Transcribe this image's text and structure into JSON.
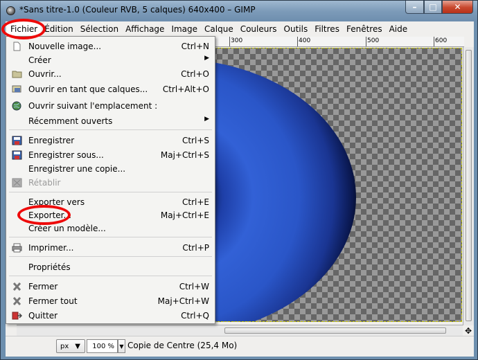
{
  "window": {
    "title": "*Sans titre-1.0 (Couleur RVB, 5 calques) 640x400 – GIMP",
    "min_label": "–",
    "max_label": "□",
    "close_label": "✕"
  },
  "menubar": [
    "Fichier",
    "Édition",
    "Sélection",
    "Affichage",
    "Image",
    "Calque",
    "Couleurs",
    "Outils",
    "Filtres",
    "Fenêtres",
    "Aide"
  ],
  "ruler": {
    "labels": [
      "300",
      "400",
      "500",
      "600"
    ]
  },
  "file_menu": {
    "items": [
      {
        "label": "Nouvelle image...",
        "shortcut": "Ctrl+N",
        "icon": "new-image-icon"
      },
      {
        "label": "Créer",
        "shortcut": "",
        "submenu": true
      },
      {
        "label": "Ouvrir...",
        "shortcut": "Ctrl+O",
        "icon": "folder-icon"
      },
      {
        "label": "Ouvrir en tant que calques...",
        "shortcut": "Ctrl+Alt+O",
        "icon": "open-layers-icon"
      },
      {
        "label": "Ouvrir suivant l'emplacement :",
        "shortcut": "",
        "icon": "globe-icon"
      },
      {
        "label": "Récemment ouverts",
        "shortcut": "",
        "submenu": true
      },
      {
        "label": "Enregistrer",
        "shortcut": "Ctrl+S",
        "icon": "save-icon"
      },
      {
        "label": "Enregistrer sous...",
        "shortcut": "Maj+Ctrl+S",
        "icon": "save-as-icon"
      },
      {
        "label": "Enregistrer une copie...",
        "shortcut": ""
      },
      {
        "label": "Rétablir",
        "shortcut": "",
        "icon": "revert-icon",
        "disabled": true
      },
      {
        "label": "Exporter vers",
        "shortcut": "Ctrl+E"
      },
      {
        "label": "Exporter...",
        "shortcut": "Maj+Ctrl+E"
      },
      {
        "label": "Créer un modèle...",
        "shortcut": ""
      },
      {
        "label": "Imprimer...",
        "shortcut": "Ctrl+P",
        "icon": "print-icon"
      },
      {
        "label": "Propriétés",
        "shortcut": ""
      },
      {
        "label": "Fermer",
        "shortcut": "Ctrl+W",
        "icon": "close-x-icon"
      },
      {
        "label": "Fermer tout",
        "shortcut": "Maj+Ctrl+W",
        "icon": "close-all-icon"
      },
      {
        "label": "Quitter",
        "shortcut": "Ctrl+Q",
        "icon": "quit-icon"
      }
    ]
  },
  "statusbar": {
    "unit": "px",
    "zoom": "100 %",
    "info": "Copie de Centre (25,4 Mo)"
  },
  "colors": {
    "highlight_oval": "#ee0a0a",
    "iris": "#3261d6"
  }
}
